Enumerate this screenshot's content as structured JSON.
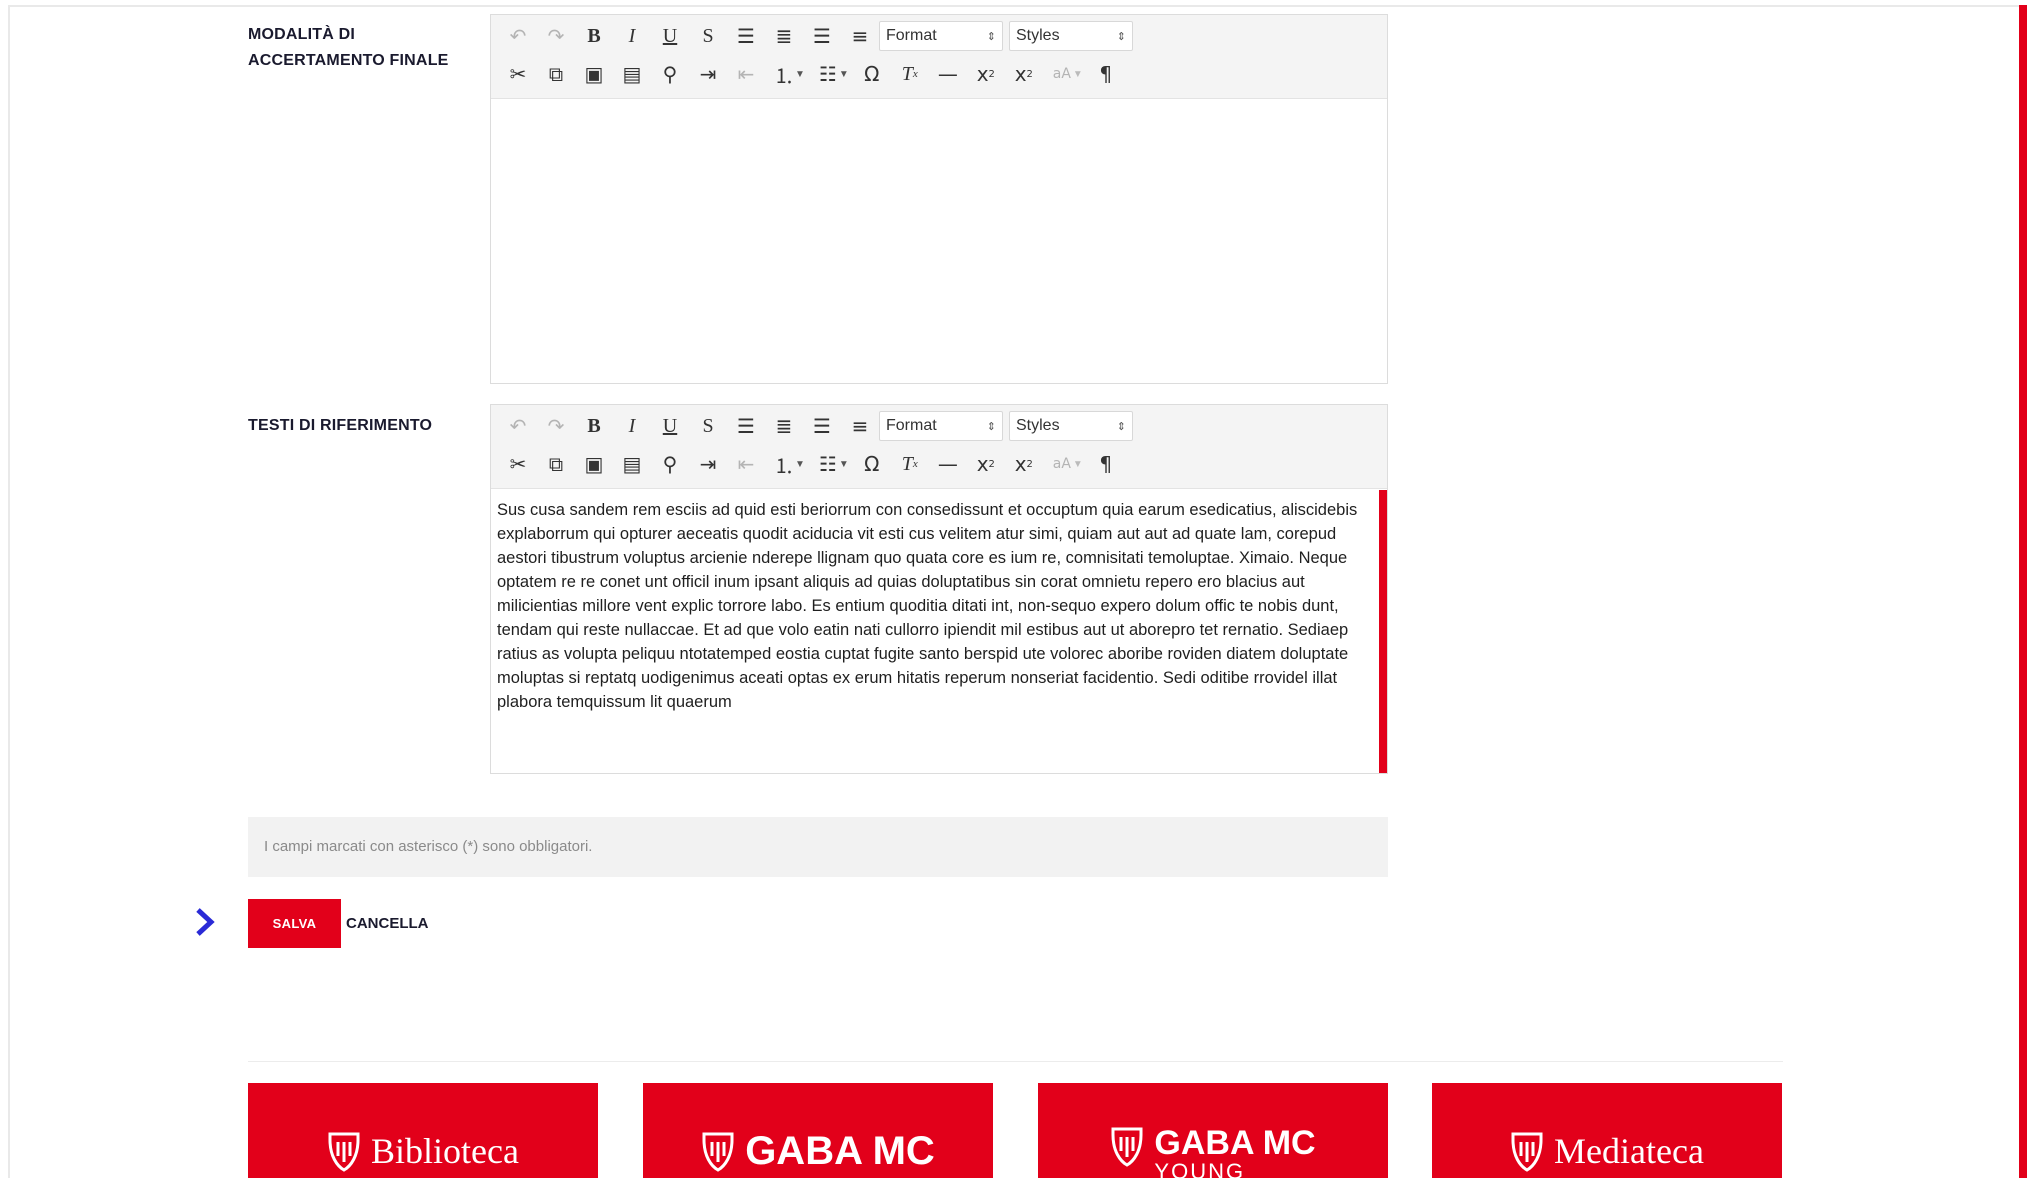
{
  "form": {
    "field1_label": "MODALITÀ DI ACCERTAMENTO FINALE",
    "field2_label": "TESTI DI RIFERIMENTO",
    "field2_value": "Sus cusa sandem rem esciis ad quid esti beriorrum con consedissunt et occuptum quia earum esedicatius, aliscidebis explaborrum qui opturer aeceatis quodit aciducia vit esti cus velitem atur simi, quiam aut aut ad quate lam, corepud aestori tibustrum voluptus arcienie nderepe llignam quo quata core es ium re, comnisitati temoluptae. Ximaio. Neque optatem re re conet unt officil inum ipsant aliquis ad quias doluptatibus sin corat omnietu repero ero blacius aut milicientias millore vent explic torrore labo. Es entium quoditia ditati int, non-sequo expero dolum offic te nobis dunt, tendam qui reste nullaccae. Et ad que volo eatin nati cullorro ipiendit mil estibus aut ut aborepro tet rernatio. Sediaep ratius as volupta peliquu ntotatemped eostia cuptat fugite santo berspid ute volorec aboribe roviden diatem doluptate moluptas si reptatq uodigenimus aceati optas ex erum hitatis reperum nonseriat facidentio. Sedi oditibe rrovidel illat plabora temquissum lit quaerum",
    "notice": "I campi marcati con asterisco (*) sono obbligatori.",
    "save_label": "SALVA",
    "cancel_label": "CANCELLA"
  },
  "toolbar": {
    "format_label": "Format",
    "styles_label": "Styles",
    "icons": [
      "undo-icon",
      "redo-icon",
      "bold-icon",
      "italic-icon",
      "underline-icon",
      "strike-icon",
      "align-justify-icon",
      "align-center-icon",
      "align-left-icon",
      "align-right-icon",
      "cut-icon",
      "copy-icon",
      "paste-icon",
      "paste-text-icon",
      "find-icon",
      "indent-icon",
      "outdent-icon",
      "numbered-list-icon",
      "bullet-list-icon",
      "special-char-icon",
      "clear-format-icon",
      "horizontal-rule-icon",
      "subscript-icon",
      "superscript-icon",
      "font-size-icon",
      "paragraph-icon"
    ]
  },
  "tiles": [
    {
      "title": "Biblioteca"
    },
    {
      "title": "GABA MC"
    },
    {
      "title": "GABA MC",
      "subtitle": "YOUNG"
    },
    {
      "title": "Mediateca"
    }
  ],
  "colors": {
    "accent": "#e2001a",
    "chevron": "#2a2ad6",
    "notice_bg": "#f2f2f2"
  }
}
